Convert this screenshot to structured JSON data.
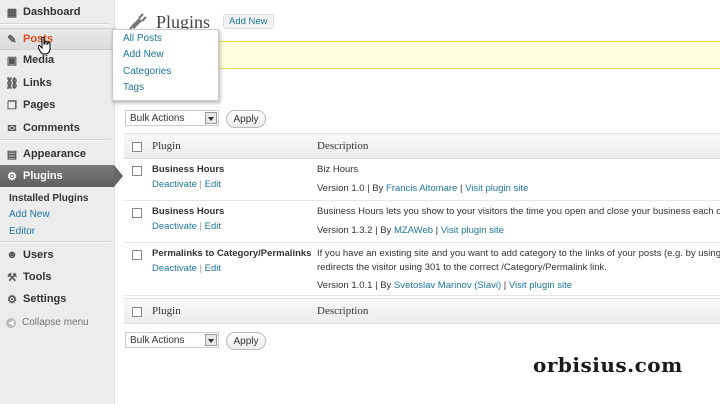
{
  "sidebar": {
    "items": [
      {
        "label": "Dashboard",
        "icon": "dashboard-icon",
        "glyph": "▦"
      },
      {
        "label": "Posts",
        "icon": "pin-icon",
        "glyph": "✎"
      },
      {
        "label": "Media",
        "icon": "media-icon",
        "glyph": "▣"
      },
      {
        "label": "Links",
        "icon": "links-icon",
        "glyph": "⛓"
      },
      {
        "label": "Pages",
        "icon": "pages-icon",
        "glyph": "❐"
      },
      {
        "label": "Comments",
        "icon": "comments-icon",
        "glyph": "✉"
      },
      {
        "label": "Appearance",
        "icon": "appearance-icon",
        "glyph": "▤"
      },
      {
        "label": "Plugins",
        "icon": "plugins-icon",
        "glyph": "⚙"
      },
      {
        "label": "Users",
        "icon": "users-icon",
        "glyph": "☻"
      },
      {
        "label": "Tools",
        "icon": "tools-icon",
        "glyph": "⚒"
      },
      {
        "label": "Settings",
        "icon": "settings-icon",
        "glyph": "⚙"
      }
    ],
    "plugins_submenu": [
      "Installed Plugins",
      "Add New",
      "Editor"
    ],
    "collapse_label": "Collapse menu"
  },
  "posts_flyout": [
    "All Posts",
    "Add New",
    "Categories",
    "Tags"
  ],
  "header": {
    "title": "Plugins",
    "add_new": "Add New"
  },
  "bulk_actions": {
    "selected": "Bulk Actions",
    "apply": "Apply"
  },
  "table": {
    "columns": [
      "Plugin",
      "Description"
    ],
    "rows": [
      {
        "name": "Business Hours",
        "deactivate": "Deactivate",
        "edit": "Edit",
        "description": "Biz Hours",
        "description2": "",
        "version": "Version 1.0",
        "by": "By",
        "author": "Francis Altomare",
        "site": "Visit plugin site"
      },
      {
        "name": "Business Hours",
        "deactivate": "Deactivate",
        "edit": "Edit",
        "description": "Business Hours lets you show to your visitors the time you open and close your business each day",
        "description2": "",
        "version": "Version 1.3.2",
        "by": "By",
        "author": "MZAWeb",
        "site": "Visit plugin site"
      },
      {
        "name": "Permalinks to Category/Permalinks",
        "deactivate": "Deactivate",
        "edit": "Edit",
        "description": "If you have an existing site and you want to add category to the links of your posts (e.g. by using this",
        "description2": "redirects the visitor using 301 to the correct /Category/Permalink link.",
        "version": "Version 1.0.1",
        "by": "By",
        "author": "Svetoslav Marinov (Slavi)",
        "site": "Visit plugin site"
      }
    ]
  },
  "watermark": "orbisius.com"
}
